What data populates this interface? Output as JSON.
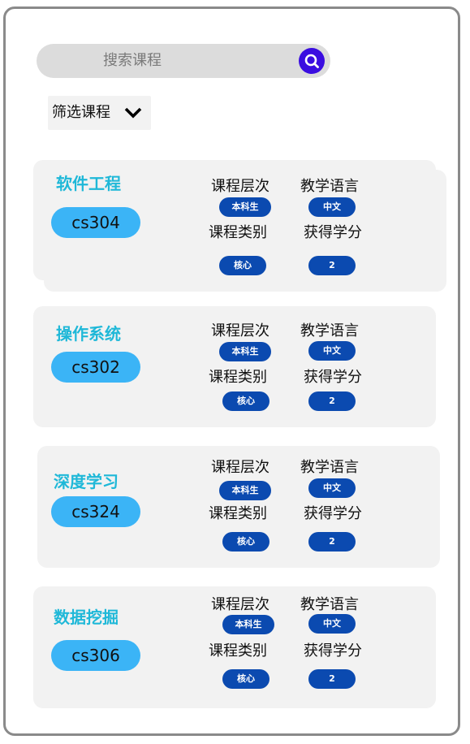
{
  "search": {
    "placeholder": "搜索课程"
  },
  "filter": {
    "label": "筛选课程"
  },
  "labels": {
    "level": "课程层次",
    "language": "教学语言",
    "category": "课程类别",
    "credits": "获得学分"
  },
  "courses": [
    {
      "name": "软件工程",
      "code": "cs304",
      "level": "本科生",
      "language": "中文",
      "category": "核心",
      "credits": "2"
    },
    {
      "name": "操作系统",
      "code": "cs302",
      "level": "本科生",
      "language": "中文",
      "category": "核心",
      "credits": "2"
    },
    {
      "name": "深度学习",
      "code": "cs324",
      "level": "本科生",
      "language": "中文",
      "category": "核心",
      "credits": "2"
    },
    {
      "name": "数据挖掘",
      "code": "cs306",
      "level": "本科生",
      "language": "中文",
      "category": "核心",
      "credits": "2"
    }
  ],
  "colors": {
    "title": "#1fb8d8",
    "code_pill": "#3bb4f6",
    "badge": "#0b4ab0",
    "search_button": "#3a0de0",
    "card_bg": "#f2f2f2"
  }
}
